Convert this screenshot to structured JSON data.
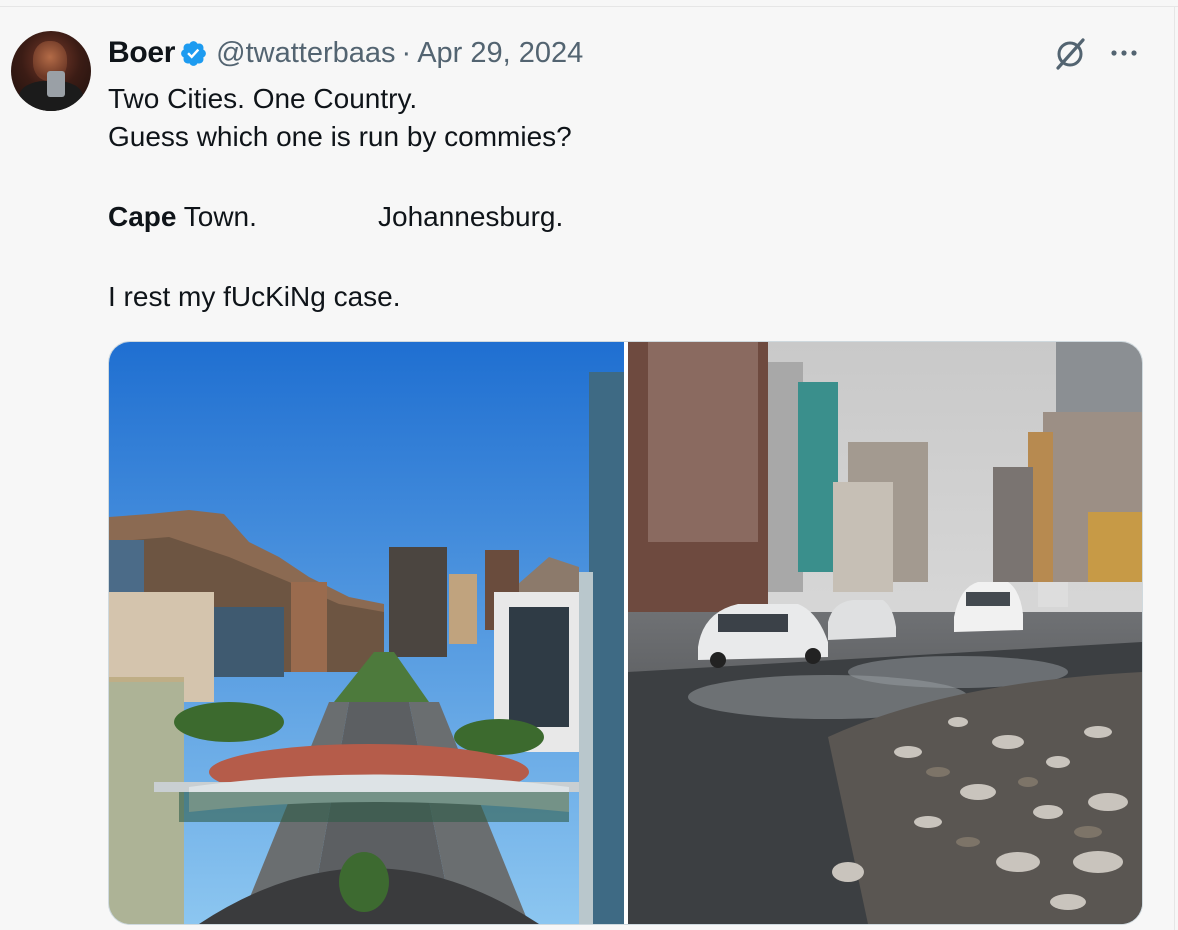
{
  "tweet": {
    "author": {
      "name": "Boer",
      "handle": "@twatterbaas",
      "verified": true,
      "avatar": "avatar"
    },
    "separator": "·",
    "date": "Apr 29, 2024",
    "lines": {
      "line1": "Two Cities. One Country.",
      "line2": "Guess which one is run by commies?",
      "cape_bold": "Cape",
      "cape_rest": " Town.",
      "johannesburg": "Johannesburg.",
      "line4": "I rest my fUcKiNg case."
    },
    "actions": {
      "grok_icon": "grok-icon",
      "more_icon": "more-options-icon"
    },
    "media": {
      "left_photo": "cape-town-photo",
      "right_photo": "johannesburg-photo"
    }
  },
  "colors": {
    "text": "#0f1419",
    "muted": "#536471",
    "verified_blue": "#1d9bf0",
    "background": "#f7f7f7",
    "border": "#cfd9de"
  }
}
